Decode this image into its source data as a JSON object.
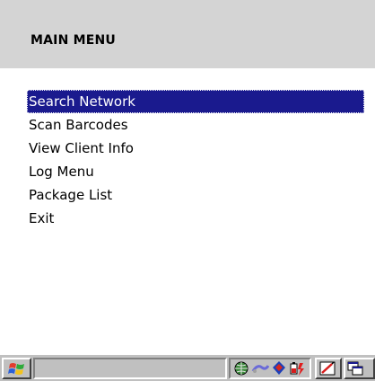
{
  "header": {
    "title": "MAIN MENU"
  },
  "menu": {
    "items": [
      {
        "label": "Search Network",
        "selected": true
      },
      {
        "label": "Scan Barcodes",
        "selected": false
      },
      {
        "label": "View Client Info",
        "selected": false
      },
      {
        "label": "Log Menu",
        "selected": false
      },
      {
        "label": "Package List",
        "selected": false
      },
      {
        "label": "Exit",
        "selected": false
      }
    ]
  },
  "colors": {
    "header_bg": "#d4d4d4",
    "selection_bg": "#1a1a8e",
    "taskbar_bg": "#c0c0c0"
  },
  "taskbar": {
    "start_icon": "windows-flag-icon",
    "tray_icons": [
      "network-globe-icon",
      "connection-icon",
      "security-shield-icon",
      "battery-power-icon"
    ],
    "right_buttons": [
      "input-panel-icon",
      "window-switch-icon"
    ]
  }
}
